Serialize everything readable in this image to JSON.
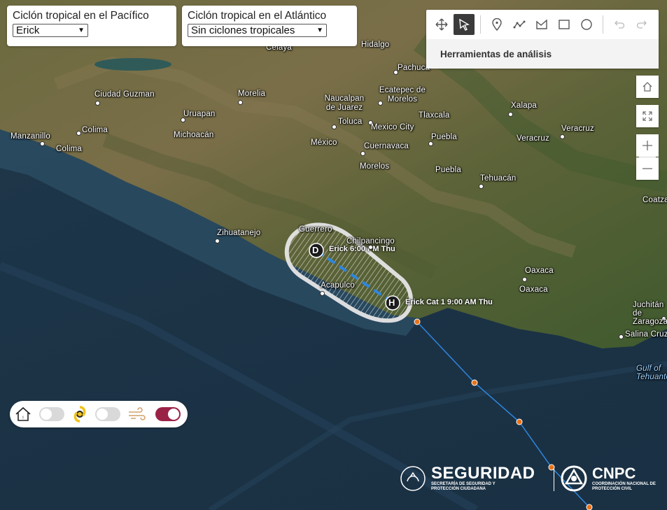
{
  "pacific_selector": {
    "label": "Ciclón tropical en el Pacífico",
    "selected": "Erick"
  },
  "atlantic_selector": {
    "label": "Ciclón tropical en el Atlántico",
    "selected": "Sin ciclones tropicales"
  },
  "toolbar": {
    "title": "Herramientas de análisis",
    "tools": [
      "move-icon",
      "select-arrow-icon",
      "point-pin-icon",
      "polyline-icon",
      "polygon-icon",
      "rectangle-icon",
      "circle-icon",
      "undo-icon",
      "redo-icon"
    ]
  },
  "map_controls": [
    "home-icon",
    "fullscreen-icon",
    "zoom-in-icon",
    "zoom-out-icon"
  ],
  "places": [
    "Celaya",
    "Hidalgo",
    "Pachuca",
    "Ciudad Guzman",
    "Morelia",
    "Naucalpan de Juarez",
    "Ecatepec de Morelos",
    "Tlaxcala",
    "Xalapa",
    "Manzanillo",
    "Colima",
    "Uruapan",
    "Michoacán",
    "Toluca",
    "Mexico City",
    "Puebla",
    "Veracruz",
    "Colima",
    "México",
    "Cuernavaca",
    "Veracruz",
    "Morelos",
    "Puebla",
    "Tehuacán",
    "Coatza",
    "Zihuatanejo",
    "Guerrero",
    "Chilpancingo",
    "Acapulco",
    "Oaxaca",
    "Oaxaca",
    "Juchitán de Zaragoza",
    "Salina Cruz",
    "Gulf of Tehuantepec"
  ],
  "storm": {
    "name": "Erick",
    "point_d_letter": "D",
    "point_d_label": "Erick 6:00 PM Thu",
    "point_h_letter": "H",
    "point_h_label": "Erick Cat 1 9:00 AM Thu"
  },
  "legend_toggles": [
    {
      "icon": "house-warning-icon",
      "on": false
    },
    {
      "icon": "hurricane-icon",
      "on": false
    },
    {
      "icon": "wind-icon",
      "on": true
    }
  ],
  "logos": {
    "seguridad_title": "SEGURIDAD",
    "seguridad_sub": "SECRETARÍA DE SEGURIDAD Y PROTECCIÓN CIUDADANA",
    "cnpc_title": "CNPC",
    "cnpc_sub": "COORDINACIÓN NACIONAL DE PROTECCIÓN CIVIL"
  },
  "colors": {
    "accent": "#9b2247",
    "track": "#2e86de",
    "track_points": "#e8731a",
    "cone_outline": "#e6e6e6"
  }
}
